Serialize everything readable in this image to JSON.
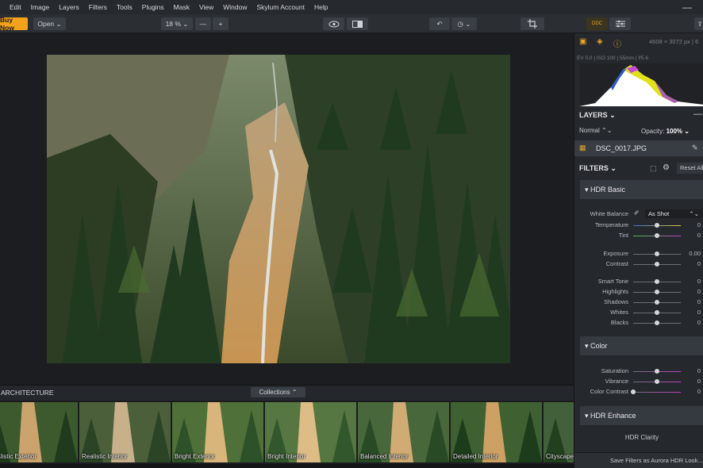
{
  "menu": [
    "Edit",
    "Image",
    "Layers",
    "Filters",
    "Tools",
    "Plugins",
    "Mask",
    "View",
    "Window",
    "Skylum Account",
    "Help"
  ],
  "toolbar": {
    "buy_now": "Buy Now",
    "open": "Open ⌄",
    "zoom": "18 % ⌄",
    "zoom_out": "—",
    "zoom_in": "+",
    "undo": "↶",
    "history": "◷ ⌄",
    "ddc": "DDC"
  },
  "image": {
    "info": "4608 × 3072 px | 6",
    "exif": "EV 0.0  |  ISO 100  |  55mm  |  f/5.6"
  },
  "strip": {
    "title": "ARCHITECTURE",
    "collections": "Collections ⌃",
    "looks": [
      "Realistic Exterior",
      "Realistic Interior",
      "Bright Exterior",
      "Bright Interior",
      "Balanced Interior",
      "Detailed Interior",
      "Cityscape"
    ]
  },
  "layers": {
    "title": "LAYERS ⌄",
    "collapse": "—",
    "blend": "Normal ⌃⌄",
    "opacity_label": "Opacity:",
    "opacity_value": "100% ⌄",
    "file": "DSC_0017.JPG"
  },
  "filters": {
    "title": "FILTERS ⌄",
    "reset_all": "Reset All",
    "hdr_basic": "▾ HDR Basic",
    "white_balance": {
      "label": "White Balance",
      "value": "As Shot"
    },
    "basic_sliders": [
      {
        "label": "Temperature",
        "value": "0",
        "level": 0.5,
        "key": "temperature"
      },
      {
        "label": "Tint",
        "value": "0",
        "level": 0.5,
        "key": "tint"
      },
      {
        "label": "Exposure",
        "value": "0.00",
        "level": 0.5,
        "key": "exposure"
      },
      {
        "label": "Contrast",
        "value": "0",
        "level": 0.5,
        "key": "contrast"
      },
      {
        "label": "Smart Tone",
        "value": "0",
        "level": 0.5,
        "key": "smart-tone"
      },
      {
        "label": "Highlights",
        "value": "0",
        "level": 0.5,
        "key": "highlights"
      },
      {
        "label": "Shadows",
        "value": "0",
        "level": 0.5,
        "key": "shadows"
      },
      {
        "label": "Whites",
        "value": "0",
        "level": 0.5,
        "key": "whites"
      },
      {
        "label": "Blacks",
        "value": "0",
        "level": 0.5,
        "key": "blacks"
      }
    ],
    "color": "▾ Color",
    "color_sliders": [
      {
        "label": "Saturation",
        "value": "0",
        "level": 0.5,
        "key": "saturation"
      },
      {
        "label": "Vibrance",
        "value": "0",
        "level": 0.5,
        "key": "vibrance"
      },
      {
        "label": "Color Contrast",
        "value": "0",
        "level": 0.0,
        "key": "color-contrast"
      }
    ],
    "hdr_enhance": "▾ HDR Enhance",
    "hdr_clarity": "HDR Clarity",
    "save_look": "Save Filters as Aurora HDR Look..."
  },
  "colors": {
    "accent": "#f2a21b",
    "panel": "#25282c",
    "section": "#353940"
  }
}
